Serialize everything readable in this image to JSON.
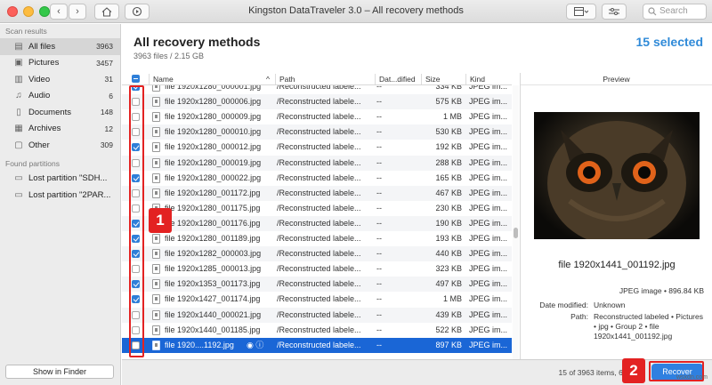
{
  "window": {
    "title": "Kingston DataTraveler 3.0 – All recovery methods",
    "search_placeholder": "Search"
  },
  "sidebar": {
    "scan_results_label": "Scan results",
    "items": [
      {
        "label": "All files",
        "count": "3963",
        "icon": "all-files-icon"
      },
      {
        "label": "Pictures",
        "count": "3457",
        "icon": "pictures-icon"
      },
      {
        "label": "Video",
        "count": "31",
        "icon": "video-icon"
      },
      {
        "label": "Audio",
        "count": "6",
        "icon": "audio-icon"
      },
      {
        "label": "Documents",
        "count": "148",
        "icon": "documents-icon"
      },
      {
        "label": "Archives",
        "count": "12",
        "icon": "archives-icon"
      },
      {
        "label": "Other",
        "count": "309",
        "icon": "other-icon"
      }
    ],
    "found_partitions_label": "Found partitions",
    "partitions": [
      {
        "label": "Lost partition \"SDH..."
      },
      {
        "label": "Lost partition \"2PAR..."
      }
    ],
    "show_in_finder": "Show in Finder"
  },
  "header": {
    "title": "All recovery methods",
    "subtitle": "3963 files / 2.15 GB",
    "selected": "15 selected"
  },
  "table": {
    "columns": [
      "Name",
      "Path",
      "Dat...dified",
      "Size",
      "Kind"
    ],
    "rows": [
      {
        "name": "file 1920x1280_000001.jpg",
        "path": "/Reconstructed labele...",
        "date": "--",
        "size": "334 KB",
        "kind": "JPEG im...",
        "checked": true
      },
      {
        "name": "file 1920x1280_000006.jpg",
        "path": "/Reconstructed labele...",
        "date": "--",
        "size": "575 KB",
        "kind": "JPEG im...",
        "checked": false
      },
      {
        "name": "file 1920x1280_000009.jpg",
        "path": "/Reconstructed labele...",
        "date": "--",
        "size": "1 MB",
        "kind": "JPEG im...",
        "checked": false
      },
      {
        "name": "file 1920x1280_000010.jpg",
        "path": "/Reconstructed labele...",
        "date": "--",
        "size": "530 KB",
        "kind": "JPEG im...",
        "checked": false
      },
      {
        "name": "file 1920x1280_000012.jpg",
        "path": "/Reconstructed labele...",
        "date": "--",
        "size": "192 KB",
        "kind": "JPEG im...",
        "checked": true
      },
      {
        "name": "file 1920x1280_000019.jpg",
        "path": "/Reconstructed labele...",
        "date": "--",
        "size": "288 KB",
        "kind": "JPEG im...",
        "checked": false
      },
      {
        "name": "file 1920x1280_000022.jpg",
        "path": "/Reconstructed labele...",
        "date": "--",
        "size": "165 KB",
        "kind": "JPEG im...",
        "checked": true
      },
      {
        "name": "file 1920x1280_001172.jpg",
        "path": "/Reconstructed labele...",
        "date": "--",
        "size": "467 KB",
        "kind": "JPEG im...",
        "checked": false
      },
      {
        "name": "file 1920x1280_001175.jpg",
        "path": "/Reconstructed labele...",
        "date": "--",
        "size": "230 KB",
        "kind": "JPEG im...",
        "checked": false
      },
      {
        "name": "file 1920x1280_001176.jpg",
        "path": "/Reconstructed labele...",
        "date": "--",
        "size": "190 KB",
        "kind": "JPEG im...",
        "checked": true
      },
      {
        "name": "file 1920x1280_001189.jpg",
        "path": "/Reconstructed labele...",
        "date": "--",
        "size": "193 KB",
        "kind": "JPEG im...",
        "checked": true
      },
      {
        "name": "file 1920x1282_000003.jpg",
        "path": "/Reconstructed labele...",
        "date": "--",
        "size": "440 KB",
        "kind": "JPEG im...",
        "checked": true
      },
      {
        "name": "file 1920x1285_000013.jpg",
        "path": "/Reconstructed labele...",
        "date": "--",
        "size": "323 KB",
        "kind": "JPEG im...",
        "checked": false
      },
      {
        "name": "file 1920x1353_001173.jpg",
        "path": "/Reconstructed labele...",
        "date": "--",
        "size": "497 KB",
        "kind": "JPEG im...",
        "checked": true
      },
      {
        "name": "file 1920x1427_001174.jpg",
        "path": "/Reconstructed labele...",
        "date": "--",
        "size": "1 MB",
        "kind": "JPEG im...",
        "checked": true
      },
      {
        "name": "file 1920x1440_000021.jpg",
        "path": "/Reconstructed labele...",
        "date": "--",
        "size": "439 KB",
        "kind": "JPEG im...",
        "checked": false
      },
      {
        "name": "file 1920x1440_001185.jpg",
        "path": "/Reconstructed labele...",
        "date": "--",
        "size": "522 KB",
        "kind": "JPEG im...",
        "checked": false
      },
      {
        "name": "file 1920....1192.jpg",
        "path": "/Reconstructed labele...",
        "date": "--",
        "size": "897 KB",
        "kind": "JPEG im...",
        "checked": false,
        "selected": true
      }
    ]
  },
  "preview": {
    "header": "Preview",
    "file_name": "file 1920x1441_001192.jpg",
    "kind_size": "JPEG image • 896.84 KB",
    "date_label": "Date modified:",
    "date_value": "Unknown",
    "path_label": "Path:",
    "path_value": "Reconstructed labeled • Pictures • jpg • Group 2 • file 1920x1441_001192.jpg"
  },
  "footer": {
    "status": "15 of 3963 items, 6.3 MB",
    "recover": "Recover"
  },
  "annotations": {
    "badge1": "1",
    "badge2": "2"
  },
  "watermark": "wsxdn.com",
  "colors": {
    "accent": "#2f80e0",
    "highlight_red": "#e32222",
    "selection_blue": "#1a66d6"
  }
}
